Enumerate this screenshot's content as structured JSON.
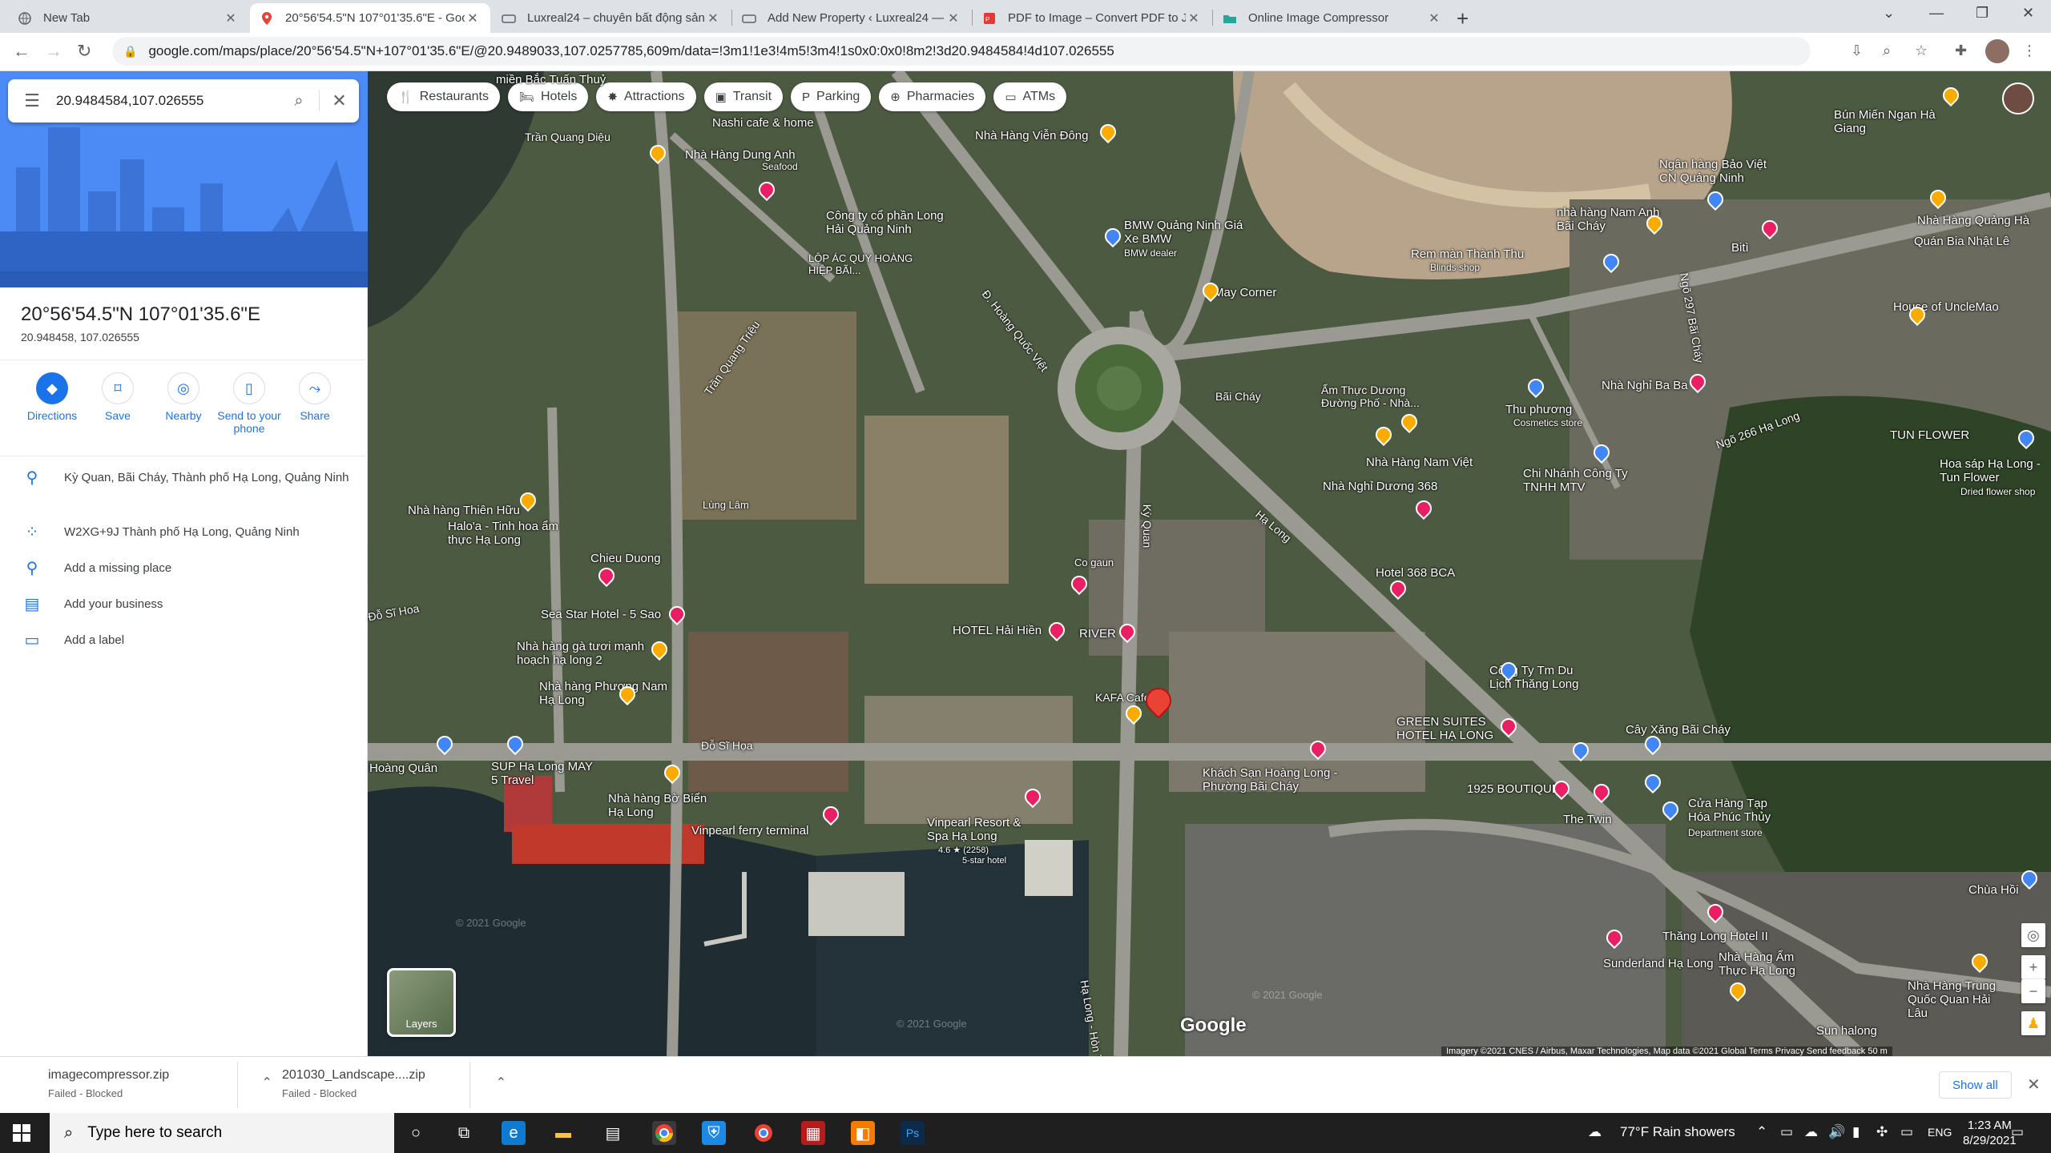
{
  "browser": {
    "tabs": [
      {
        "title": "New Tab",
        "active": false
      },
      {
        "title": "20°56'54.5\"N 107°01'35.6\"E - Goo",
        "active": true
      },
      {
        "title": "Luxreal24 – chuyên bất động sản",
        "active": false
      },
      {
        "title": "Add New Property ‹ Luxreal24 —",
        "active": false
      },
      {
        "title": "PDF to Image – Convert PDF to JP",
        "active": false
      },
      {
        "title": "Online Image Compressor",
        "active": false
      }
    ],
    "url": "google.com/maps/place/20°56'54.5\"N+107°01'35.6\"E/@20.9489033,107.0257785,609m/data=!3m1!1e3!4m5!3m4!1s0x0:0x0!8m2!3d20.9484584!4d107.026555"
  },
  "sidebar": {
    "search_value": "20.9484584,107.026555",
    "title": "20°56'54.5\"N 107°01'35.6\"E",
    "subtitle": "20.948458, 107.026555",
    "actions": [
      {
        "label": "Directions",
        "icon": "directions-icon"
      },
      {
        "label": "Save",
        "icon": "bookmark-icon"
      },
      {
        "label": "Nearby",
        "icon": "nearby-icon"
      },
      {
        "label": "Send to your phone",
        "icon": "phone-icon"
      },
      {
        "label": "Share",
        "icon": "share-icon"
      }
    ],
    "info": [
      {
        "text": "Kỳ Quan, Bãi Cháy, Thành phố Hạ Long, Quảng Ninh",
        "icon": "location-pin-icon"
      },
      {
        "text": "W2XG+9J Thành phố Hạ Long, Quảng Ninh",
        "icon": "plus-code-icon"
      },
      {
        "text": "Add a missing place",
        "icon": "add-place-icon"
      },
      {
        "text": "Add your business",
        "icon": "business-icon"
      },
      {
        "text": "Add a label",
        "icon": "label-icon"
      }
    ]
  },
  "map": {
    "chips": [
      {
        "label": "Restaurants",
        "icon": "fork-knife-icon"
      },
      {
        "label": "Hotels",
        "icon": "bed-icon"
      },
      {
        "label": "Attractions",
        "icon": "camera-icon"
      },
      {
        "label": "Transit",
        "icon": "bus-icon"
      },
      {
        "label": "Parking",
        "icon": "parking-icon"
      },
      {
        "label": "Pharmacies",
        "icon": "pharmacy-icon"
      },
      {
        "label": "ATMs",
        "icon": "atm-icon"
      }
    ],
    "labels": [
      "miền Bắc Tuấn Thuỷ",
      "Trần Quang Diệu",
      "Nashi cafe & home",
      "Nhà Hàng Dung Anh",
      "Seafood",
      "Nhà Hàng Viễn Đông",
      "Công ty cổ phần Long Hải Quảng Ninh",
      "LỘP ÁC QUY HOÀNG HIỆP BÃI...",
      "Trần Quang Triệu",
      "Đ. Hoàng Quốc Việt",
      "BMW Quảng Ninh Giá Xe BMW",
      "BMW dealer",
      "May Corner",
      "Bãi Cháy",
      "Ẩm Thực Dương Đường Phố - Nhà...",
      "Nhà Hàng Nam Việt",
      "Nhà Nghỉ Dương 368",
      "Hotel 368 BCA",
      "Lùng Lâm",
      "Hạ Long",
      "Nhà hàng Thiên Hữu",
      "Halo'a - Tinh hoa ẩm thực Hạ Long",
      "Chieu Duong",
      "Co gaun",
      "Sea Star Hotel - 5 Sao",
      "HOTEL Hải Hiền",
      "RIVER",
      "Nhà hàng gà tươi mạnh hoạch hạ long 2",
      "Nhà hàng Phương Nam Hạ Long",
      "KAFA Cafe",
      "Đỗ Sĩ Họa",
      "Kỳ Quan",
      "SUP Hạ Long MAY 5 Travel",
      "Nhà hàng Bờ Biển Hạ Long",
      "Vinpearl ferry terminal",
      "Vinpearl Resort & Spa Hạ Long",
      "4.6 ★ (2258)",
      "5-star hotel",
      "Khách Sạn Hoàng Long - Phường Bãi Cháy",
      "GREEN SUITES HOTEL HẠ LONG",
      "1925 BOUTIQUE",
      "The Twin",
      "Công Ty Tm Du Lịch Thăng Long",
      "Cây Xăng Bãi Cháy",
      "Cửa Hàng Tạp Hóa Phúc Thủy",
      "Department store",
      "Thăng Long Hotel II",
      "Sunderland Hạ Long",
      "Nhà Hàng Ẩm Thực Hạ Long",
      "Nhà Hàng Trung Quốc Quan Hải Lâu",
      "Chùa Hồi",
      "Sun halong",
      "TUN FLOWER",
      "Hoa sáp Hạ Long - Tun Flower",
      "Dried flower shop",
      "House of UncleMao",
      "Nhà Nghỉ Ba Ba",
      "Ngõ 266 Hạ Long",
      "Chi Nhánh Công Ty TNHH MTV",
      "Thu phương",
      "Cosmetics store",
      "Rem màn Thành Thu",
      "Blinds shop",
      "nhà hàng Nam Anh Bãi Cháy",
      "Ngân hàng Bảo Việt CN Quảng Ninh",
      "Bún Miến Ngan Hà Giang",
      "Nhà Hàng Quảng Hà",
      "Quán Bia Nhật Lê",
      "Bitì",
      "Ngõ 297 Bãi Cháy",
      "Hạ Long - Hòn Tr",
      "Hoàng Quân",
      "Đỗ Sĩ Hoa"
    ],
    "layers_label": "Layers",
    "logo": "Google",
    "attribution": "Imagery ©2021 CNES / Airbus, Maxar Technologies, Map data ©2021   Global   Terms   Privacy   Send feedback   50 m",
    "watermark": "© 2021 Google"
  },
  "downloads": [
    {
      "name": "imagecompressor.zip",
      "status": "Failed - Blocked"
    },
    {
      "name": "201030_Landscape....zip",
      "status": "Failed - Blocked"
    }
  ],
  "downloads_show_all": "Show all",
  "taskbar": {
    "search_placeholder": "Type here to search",
    "weather": "77°F  Rain showers",
    "lang": "ENG",
    "time": "1:23 AM",
    "date": "8/29/2021"
  }
}
